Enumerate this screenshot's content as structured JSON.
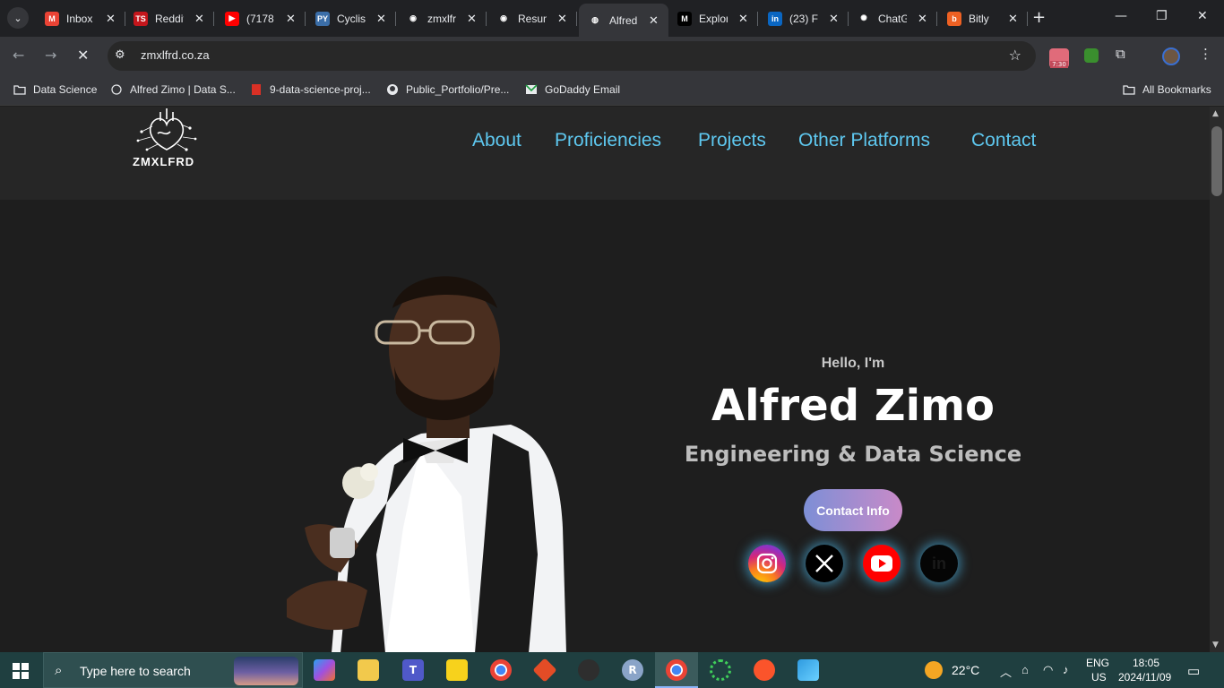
{
  "browser": {
    "tabs": [
      {
        "label": "Inbox",
        "favicon": "gmail-icon",
        "color": "#ea4335",
        "glyph": "M"
      },
      {
        "label": "Reddit",
        "favicon": "ts-icon",
        "color": "#c4161c",
        "glyph": "TS"
      },
      {
        "label": "(7178",
        "favicon": "youtube-icon",
        "color": "#ff0000",
        "glyph": "▶"
      },
      {
        "label": "Cyclist",
        "favicon": "py-icon",
        "color": "#3b6ea8",
        "glyph": "PY"
      },
      {
        "label": "zmxlfrd",
        "favicon": "github-icon",
        "color": "#202124",
        "glyph": "◉"
      },
      {
        "label": "Resume",
        "favicon": "github-icon",
        "color": "#202124",
        "glyph": "◉"
      },
      {
        "label": "Alfred",
        "favicon": "site-icon",
        "color": "#35363a",
        "glyph": "◍",
        "active": true
      },
      {
        "label": "Explore",
        "favicon": "medium-icon",
        "color": "#000000",
        "glyph": "M"
      },
      {
        "label": "(23) F",
        "favicon": "linkedin-icon",
        "color": "#0a66c2",
        "glyph": "in"
      },
      {
        "label": "ChatGPT",
        "favicon": "chatgpt-icon",
        "color": "#202124",
        "glyph": "✺"
      },
      {
        "label": "Bitly",
        "favicon": "bitly-icon",
        "color": "#ee6123",
        "glyph": "b"
      }
    ],
    "url": "zmxlfrd.co.za",
    "extension_badge": "7:30",
    "bookmarks": [
      {
        "label": "Data Science",
        "icon": "folder-icon"
      },
      {
        "label": "Alfred Zimo | Data S...",
        "icon": "site-icon"
      },
      {
        "label": "9-data-science-proj...",
        "icon": "pdf-icon"
      },
      {
        "label": "Public_Portfolio/Pre...",
        "icon": "github-icon"
      },
      {
        "label": "GoDaddy Email",
        "icon": "mail-icon"
      }
    ],
    "all_bookmarks": "All Bookmarks"
  },
  "site": {
    "logo_text": "ZMXLFRD",
    "nav": [
      "About",
      "Proficiencies",
      "Projects",
      "Other Platforms",
      "Contact"
    ],
    "nav_color": "#5ec8f0",
    "hero": {
      "greeting": "Hello, I'm",
      "name": "Alfred Zimo",
      "role": "Engineering & Data Science",
      "button": "Contact Info"
    },
    "socials": [
      "instagram-icon",
      "x-icon",
      "youtube-icon",
      "linkedin-icon"
    ]
  },
  "taskbar": {
    "search_placeholder": "Type here to search",
    "weather": "22°C",
    "lang_top": "ENG",
    "lang_bottom": "US",
    "time": "18:05",
    "date": "2024/11/09"
  }
}
